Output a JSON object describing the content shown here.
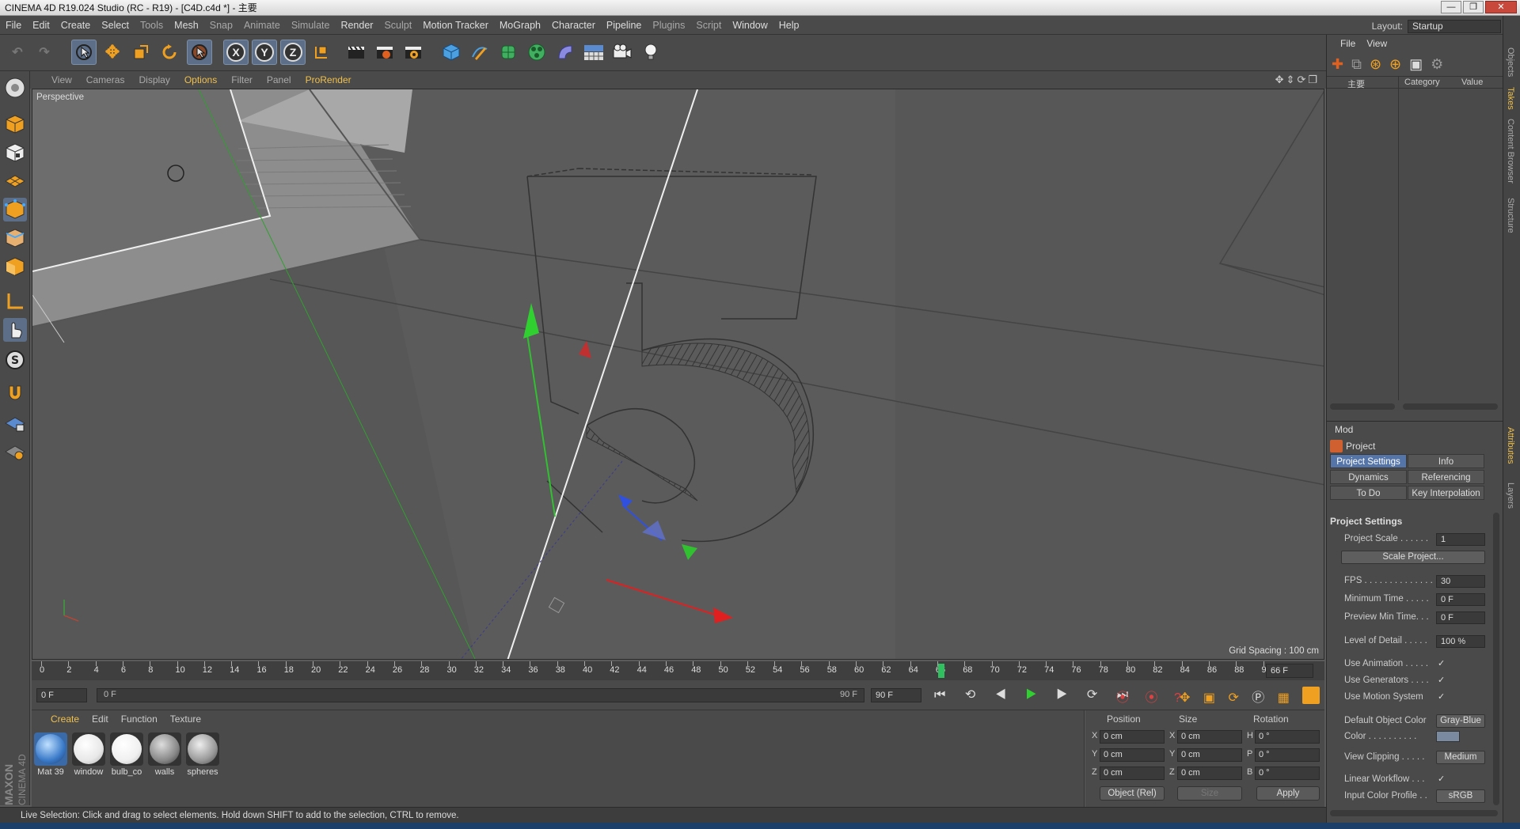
{
  "window": {
    "title": "CINEMA 4D R19.024 Studio (RC - R19) - [C4D.c4d *] - 主要"
  },
  "menubar": {
    "items": [
      "File",
      "Edit",
      "Create",
      "Select",
      "Tools",
      "Mesh",
      "Snap",
      "Animate",
      "Simulate",
      "Render",
      "Sculpt",
      "Motion Tracker",
      "MoGraph",
      "Character",
      "Pipeline",
      "Plugins",
      "Script",
      "Window",
      "Help"
    ],
    "layout_label": "Layout:",
    "layout_value": "Startup"
  },
  "viewport": {
    "menu": [
      "View",
      "Cameras",
      "Display",
      "Options",
      "Filter",
      "Panel",
      "ProRender"
    ],
    "camera_label": "Perspective",
    "grid_spacing": "Grid Spacing : 100 cm"
  },
  "timeline": {
    "ticks": [
      "0",
      "2",
      "4",
      "6",
      "8",
      "10",
      "12",
      "14",
      "16",
      "18",
      "20",
      "22",
      "24",
      "26",
      "28",
      "30",
      "32",
      "34",
      "36",
      "38",
      "40",
      "42",
      "44",
      "46",
      "48",
      "50",
      "52",
      "54",
      "56",
      "58",
      "60",
      "62",
      "64",
      "66",
      "68",
      "70",
      "72",
      "74",
      "76",
      "78",
      "80",
      "82",
      "84",
      "86",
      "88",
      "90"
    ],
    "current_frame": "66 F",
    "start_field": "0 F",
    "range_start": "0 F",
    "range_end": "90 F",
    "end_field": "90 F"
  },
  "materials": {
    "menu": [
      "Create",
      "Edit",
      "Function",
      "Texture"
    ],
    "items": [
      {
        "name": "Mat 39"
      },
      {
        "name": "window"
      },
      {
        "name": "bulb_co"
      },
      {
        "name": "walls"
      },
      {
        "name": "spheres"
      }
    ]
  },
  "coordinates": {
    "headers": [
      "Position",
      "Size",
      "Rotation"
    ],
    "rows": [
      {
        "p_axis": "X",
        "p": "0 cm",
        "s_axis": "X",
        "s": "0 cm",
        "r_axis": "H",
        "r": "0 °"
      },
      {
        "p_axis": "Y",
        "p": "0 cm",
        "s_axis": "Y",
        "s": "0 cm",
        "r_axis": "P",
        "r": "0 °"
      },
      {
        "p_axis": "Z",
        "p": "0 cm",
        "s_axis": "Z",
        "s": "0 cm",
        "r_axis": "B",
        "r": "0 °"
      }
    ],
    "mode": "Object (Rel)",
    "size_mode": "Size",
    "apply": "Apply"
  },
  "status": "Live Selection: Click and drag to select elements. Hold down SHIFT to add to the selection, CTRL to remove.",
  "objects_panel": {
    "menu": [
      "File",
      "View"
    ],
    "take_name": "主要",
    "columns": [
      "Category",
      "Value"
    ]
  },
  "attributes": {
    "mode_label": "Mod",
    "object": "Project",
    "tabs": [
      "Project Settings",
      "Info",
      "Dynamics",
      "Referencing",
      "To Do",
      "Key Interpolation"
    ],
    "section": "Project Settings",
    "rows": {
      "project_scale": {
        "label": "Project Scale . . . . . .",
        "value": "1"
      },
      "scale_project": "Scale Project...",
      "fps": {
        "label": "FPS . . . . . . . . . . . . . .",
        "value": "30"
      },
      "min_time": {
        "label": "Minimum Time . . . . .",
        "value": "0 F"
      },
      "preview_min": {
        "label": "Preview Min Time. . .",
        "value": "0 F"
      },
      "lod": {
        "label": "Level of Detail . . . . .",
        "value": "100 %"
      },
      "use_animation": {
        "label": "Use Animation . . . . .",
        "value": "✓"
      },
      "use_generators": {
        "label": "Use Generators . . . .",
        "value": "✓"
      },
      "use_motion": {
        "label": "Use Motion System",
        "value": "✓"
      },
      "default_color": {
        "label": "Default Object Color",
        "value": "Gray-Blue"
      },
      "color": {
        "label": "Color . . . . . . . . . ."
      },
      "view_clipping": {
        "label": "View Clipping . . . . .",
        "value": "Medium"
      },
      "linear_workflow": {
        "label": "Linear Workflow . . .",
        "value": "✓"
      },
      "input_profile": {
        "label": "Input Color Profile . .",
        "value": "sRGB"
      }
    }
  },
  "side_tabs": [
    "Objects",
    "Takes",
    "Content Browser",
    "Structure",
    "Attributes",
    "Layers"
  ],
  "brand": {
    "maxon": "MAXON",
    "c4d": "CINEMA 4D"
  },
  "colors": {
    "accent": "#f0c04a",
    "selected_tab": "#5575a8",
    "x_axis": "#e02020",
    "y_axis": "#20c020",
    "z_axis": "#2040e0"
  }
}
